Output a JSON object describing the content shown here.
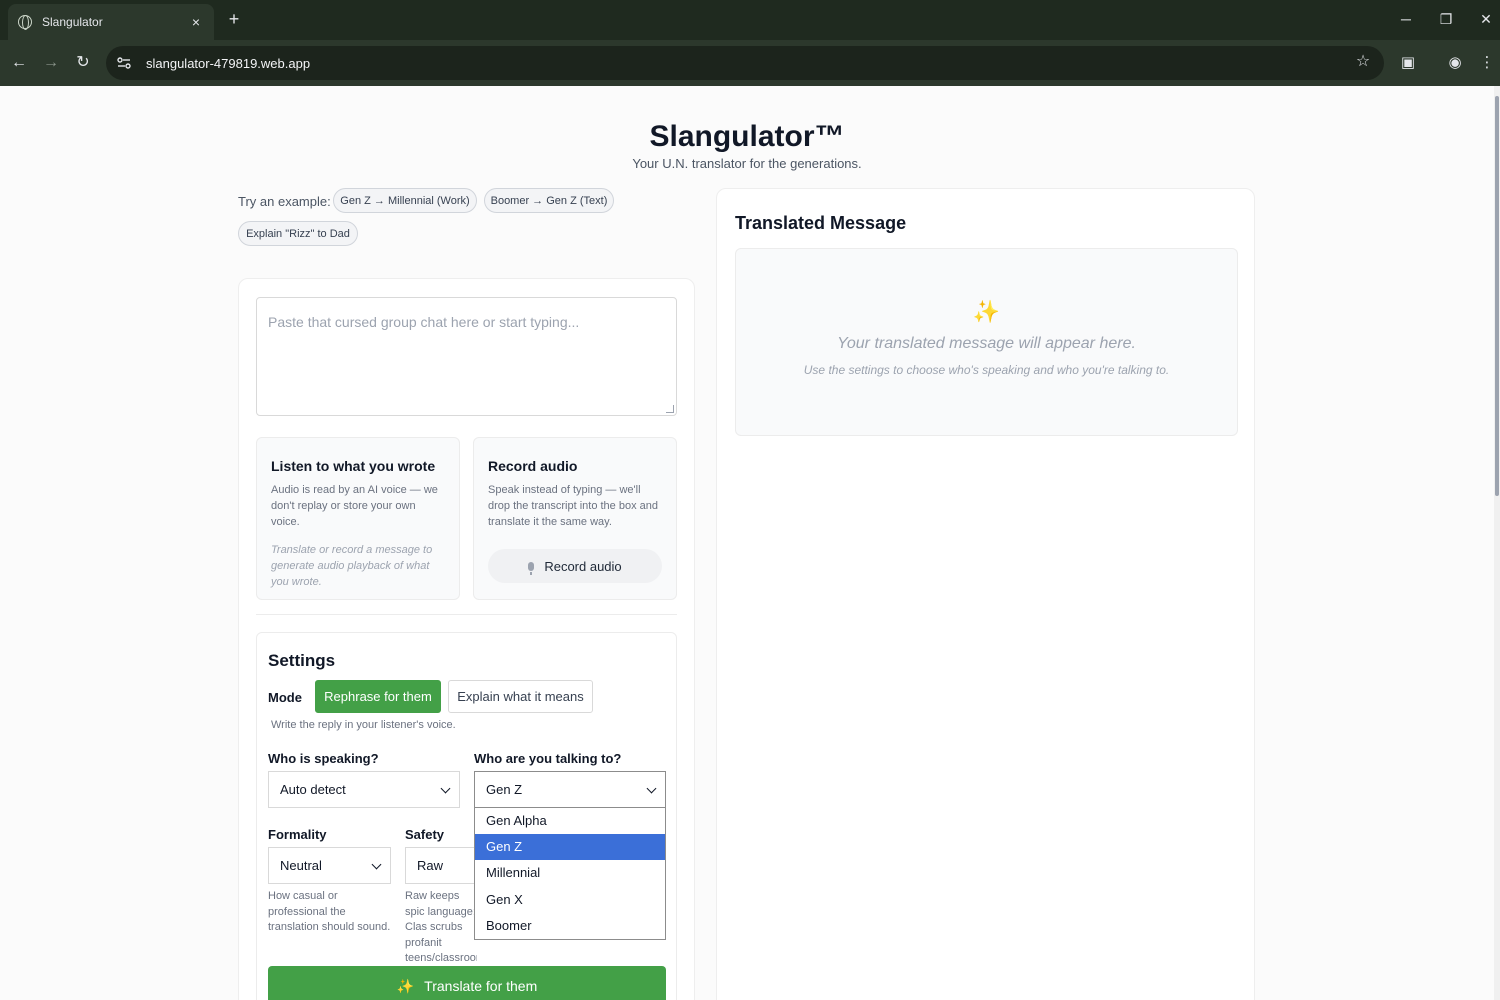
{
  "browser": {
    "tab_title": "Slangulator",
    "tab_close": "×",
    "new_tab": "+",
    "url": "slangulator-479819.web.app",
    "window_controls": {
      "minimize": "─",
      "restore": "❐",
      "close": "✕"
    },
    "nav": {
      "back": "←",
      "forward": "→",
      "reload": "↻"
    },
    "icons": {
      "star": "☆",
      "menu": "⋮",
      "profile": "◉",
      "sidepanel": "▣"
    }
  },
  "header": {
    "title": "Slangulator™",
    "subtitle": "Your U.N. translator for the generations."
  },
  "examples": {
    "label": "Try an example:",
    "chips": [
      "Gen Z → Millennial (Work)",
      "Boomer → Gen Z (Text)",
      "Explain \"Rizz\" to Dad"
    ]
  },
  "input": {
    "placeholder": "Paste that cursed group chat here or start typing..."
  },
  "listen_panel": {
    "title": "Listen to what you wrote",
    "description": "Audio is read by an AI voice — we don't replay or store your own voice.",
    "hint": "Translate or record a message to generate audio playback of what you wrote."
  },
  "record_panel": {
    "title": "Record audio",
    "description": "Speak instead of typing — we'll drop the transcript into the box and translate it the same way.",
    "button": "Record audio",
    "mic_icon": "microphone-icon"
  },
  "settings": {
    "title": "Settings",
    "mode_label": "Mode",
    "mode_options": [
      "Rephrase for them",
      "Explain what it means"
    ],
    "mode_active": "Rephrase for them",
    "mode_help": "Write the reply in your listener's voice.",
    "speaker_label": "Who is speaking?",
    "speaker_value": "Auto detect",
    "listener_label": "Who are you talking to?",
    "listener_value": "Gen Z",
    "listener_options": [
      "Gen Alpha",
      "Gen Z",
      "Millennial",
      "Gen X",
      "Boomer"
    ],
    "formality_label": "Formality",
    "formality_value": "Neutral",
    "formality_help": "How casual or professional the translation should sound.",
    "safety_label": "Safety",
    "safety_value": "Raw",
    "safety_help": "Raw keeps spic language; Clas scrubs profanit teens/classrooms."
  },
  "translate_button": {
    "icon": "✨",
    "label": "Translate for them"
  },
  "output": {
    "title": "Translated Message",
    "icon": "✨",
    "empty_headline": "Your translated message will appear here.",
    "empty_subline": "Use the settings to choose who's speaking and who you're talking to."
  },
  "colors": {
    "accent_green": "#43a047",
    "dropdown_highlight": "#3b6fd8",
    "chrome_bg": "#1f2a1f"
  }
}
